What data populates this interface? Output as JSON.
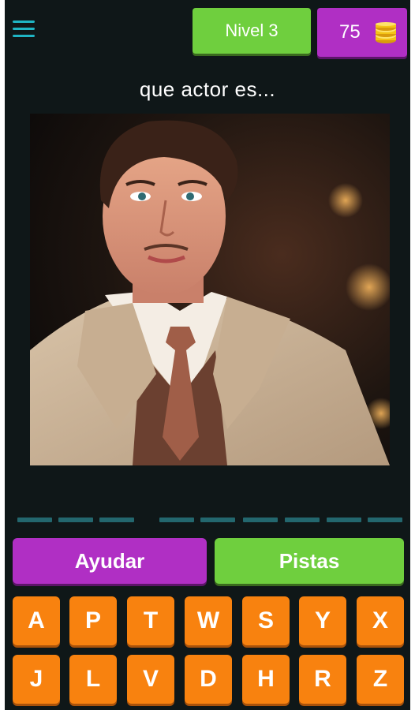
{
  "header": {
    "level_label": "Nivel 3",
    "coins": "75",
    "coin_icon": "coins-stack-icon",
    "menu_icon": "hamburger-menu-icon"
  },
  "question": "que actor es...",
  "image": {
    "description_icon": "actor-portrait-image"
  },
  "answer": {
    "slots_word1": 3,
    "slots_word2": 6
  },
  "actions": {
    "help_label": "Ayudar",
    "hints_label": "Pistas"
  },
  "keyboard": {
    "row1": [
      "A",
      "P",
      "T",
      "W",
      "S",
      "Y",
      "X"
    ],
    "row2": [
      "J",
      "L",
      "V",
      "D",
      "H",
      "R",
      "Z"
    ]
  },
  "colors": {
    "background": "#0f1718",
    "green": "#6fcf3e",
    "purple": "#b02fc4",
    "orange": "#f8820f",
    "slot": "#23676e",
    "menu": "#1fb5c4",
    "coin": "#f3c316"
  }
}
